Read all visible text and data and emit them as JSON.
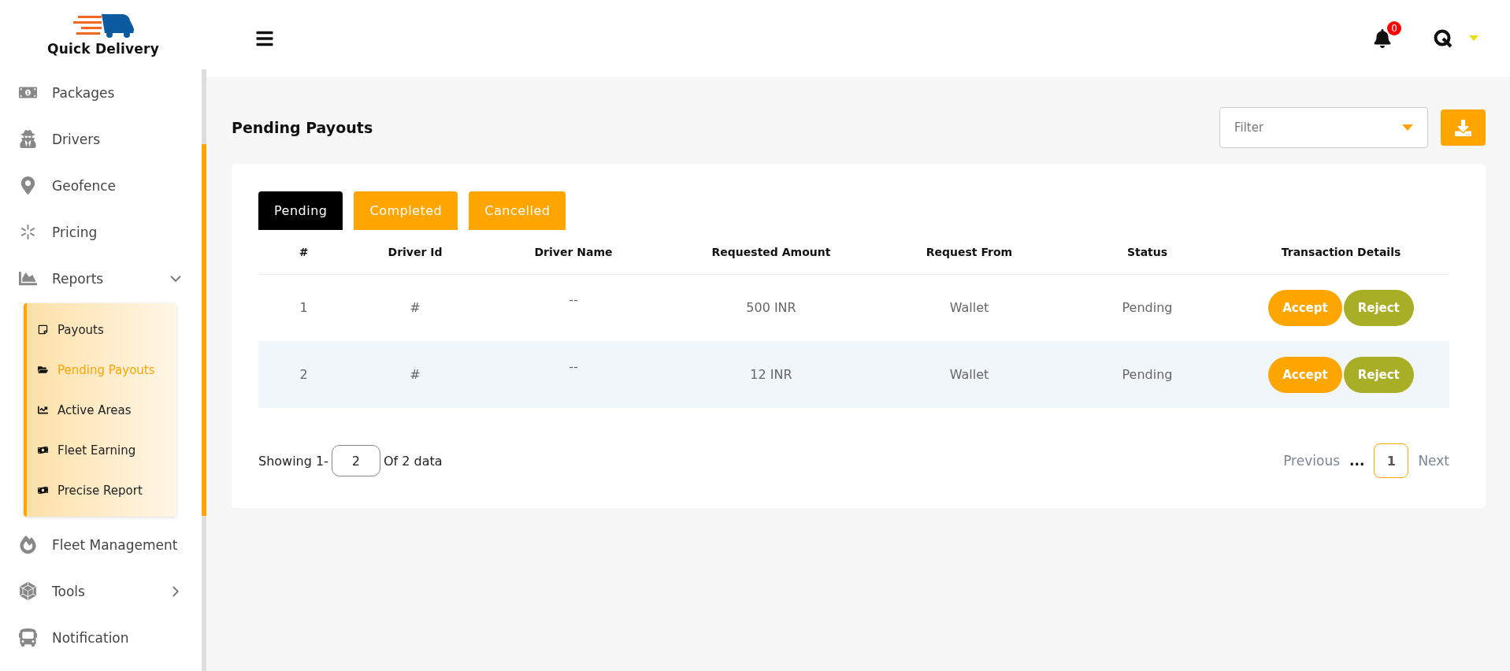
{
  "logo": {
    "text": "Quick Delivery"
  },
  "sidebar": {
    "items": [
      {
        "label": "Packages",
        "kind": "link"
      },
      {
        "label": "Drivers",
        "kind": "link"
      },
      {
        "label": "Geofence",
        "kind": "link"
      },
      {
        "label": "Pricing",
        "kind": "link"
      },
      {
        "label": "Reports",
        "kind": "group",
        "expanded": true,
        "children": [
          {
            "label": "Payouts",
            "selected": false
          },
          {
            "label": "Pending Payouts",
            "selected": true
          },
          {
            "label": "Active Areas",
            "selected": false
          },
          {
            "label": "Fleet Earning",
            "selected": false
          },
          {
            "label": "Precise Report",
            "selected": false
          }
        ]
      },
      {
        "label": "Fleet Management",
        "kind": "link"
      },
      {
        "label": "Tools",
        "kind": "group",
        "expanded": false
      },
      {
        "label": "Notification",
        "kind": "link"
      }
    ]
  },
  "header": {
    "notification_count": "0"
  },
  "page": {
    "title": "Pending Payouts",
    "filter": {
      "placeholder": "Filter"
    }
  },
  "tabs": [
    {
      "label": "Pending",
      "selected": true
    },
    {
      "label": "Completed",
      "selected": false
    },
    {
      "label": "Cancelled",
      "selected": false
    }
  ],
  "table": {
    "columns": [
      "#",
      "Driver Id",
      "Driver Name",
      "Requested Amount",
      "Request From",
      "Status",
      "Transaction Details"
    ],
    "rows": [
      {
        "cells": [
          "1",
          "#",
          "--",
          "500 INR",
          "Wallet",
          "Pending"
        ],
        "actions": [
          "Accept",
          "Reject"
        ]
      },
      {
        "cells": [
          "2",
          "#",
          "--",
          "12 INR",
          "Wallet",
          "Pending"
        ],
        "actions": [
          "Accept",
          "Reject"
        ]
      }
    ]
  },
  "footer": {
    "showing": "Showing 1-",
    "page_size": "2",
    "total": "Of 2 data",
    "previous": "Previous",
    "ellipsis": "...",
    "pages": [
      {
        "label": "1",
        "selected": true
      }
    ],
    "next": "Next"
  }
}
